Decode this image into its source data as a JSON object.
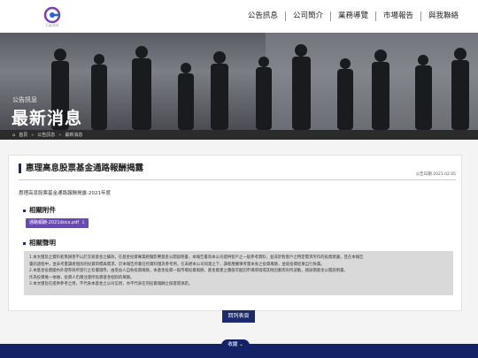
{
  "brand": {
    "logo_text": "Capital"
  },
  "nav": {
    "items": [
      {
        "label": "公告訊息"
      },
      {
        "label": "公司簡介"
      },
      {
        "label": "業務導覽"
      },
      {
        "label": "市場報告"
      },
      {
        "label": "與我聯絡"
      }
    ]
  },
  "hero": {
    "subtitle": "公告訊息",
    "title": "最新消息"
  },
  "breadcrumb": {
    "home": "首頁",
    "level1": "公告訊息",
    "level2": "最新消息",
    "separator": "»"
  },
  "article": {
    "title": "惠理高息股票基金通路報酬揭露",
    "date": "公告日期 2021.02.05",
    "subtitle": "惠理高息股票基金通路報酬揭露-2021年度",
    "attachments_heading": "相關附件",
    "attachment_label": "通路報酬-2021docx.pdf",
    "disclaimer_heading": "相關聲明",
    "disclaimer_lines": [
      "1.本文僅及之資料者無損害不以於交易基金之績效，在基金投資專業經驗影響基金公開說明書，本報告書為本公司提供客戶之一般參考資料，並非針對客戶之特定需求所作的投資建議，且在本報告",
      "書訊過程中，並未考量讀者個別的投資目標與需求，於本報告所載任何資料僅為參考用，在未經本公司同意之下，讀者應審慎考量本身之投資風險，並就投資結果自行負責。",
      "2.本基金投資國內外證券商所發行之有價證券，由受益人自負投資風險，本基金投資一般市場投資風險，基金資產之價值可能因市場環境或其他因素而有所波動，請詳閱基金公開說明書。",
      "作為投資唯一依據，投資人仍應注意所投資基金個別的風險。",
      "3.本文僅旨在提供參考之用，不代表本基金之公司信用，亦不代表任何投資報酬之保證或承諾。"
    ]
  },
  "list_button": "回列表頁",
  "footer": {
    "tab_label": "收闔"
  }
}
